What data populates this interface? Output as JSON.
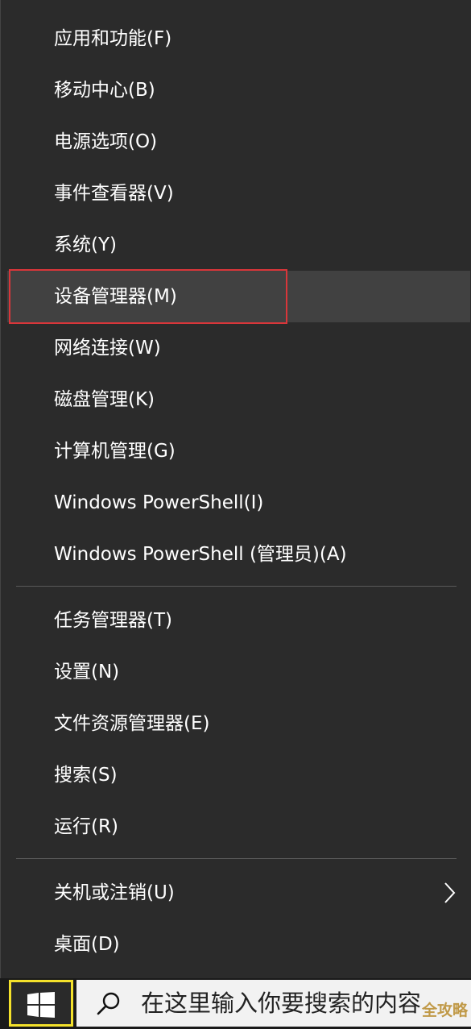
{
  "menu": {
    "group1": [
      {
        "label": "应用和功能(F)"
      },
      {
        "label": "移动中心(B)"
      },
      {
        "label": "电源选项(O)"
      },
      {
        "label": "事件查看器(V)"
      },
      {
        "label": "系统(Y)"
      },
      {
        "label": "设备管理器(M)"
      },
      {
        "label": "网络连接(W)"
      },
      {
        "label": "磁盘管理(K)"
      },
      {
        "label": "计算机管理(G)"
      },
      {
        "label": "Windows PowerShell(I)"
      },
      {
        "label": "Windows PowerShell (管理员)(A)"
      }
    ],
    "group2": [
      {
        "label": "任务管理器(T)"
      },
      {
        "label": "设置(N)"
      },
      {
        "label": "文件资源管理器(E)"
      },
      {
        "label": "搜索(S)"
      },
      {
        "label": "运行(R)"
      }
    ],
    "group3": [
      {
        "label": "关机或注销(U)",
        "submenu_icon": "chevron-right-icon"
      },
      {
        "label": "桌面(D)"
      }
    ]
  },
  "taskbar": {
    "start_icon": "windows-logo-icon",
    "search_icon": "search-icon",
    "search_placeholder": "在这里输入你要搜索的内容"
  },
  "watermark": "全攻略",
  "colors": {
    "menu_bg": "#2b2b2b",
    "hover_bg": "#414141",
    "highlight_border": "#d9363a",
    "start_border": "#f4e12b",
    "text": "#ffffff"
  }
}
